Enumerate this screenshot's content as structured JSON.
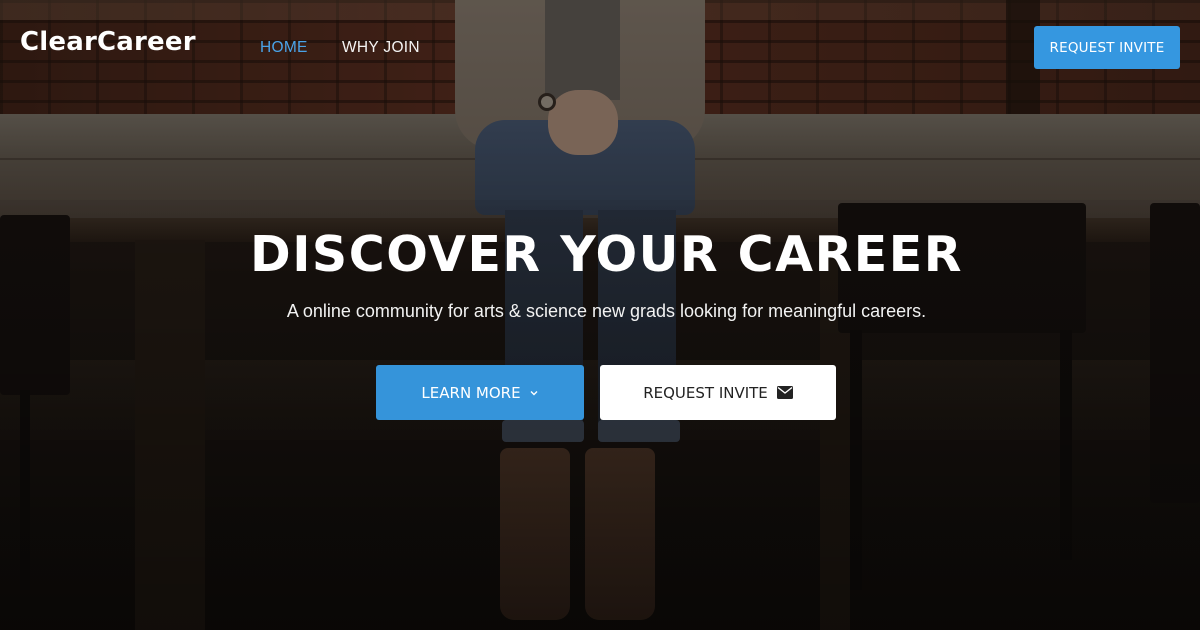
{
  "brand": {
    "name": "ClearCareer"
  },
  "nav": {
    "links": [
      {
        "label": "HOME",
        "active": true
      },
      {
        "label": "WHY JOIN",
        "active": false
      }
    ],
    "cta_label": "REQUEST INVITE"
  },
  "hero": {
    "headline": "DISCOVER YOUR CAREER",
    "subheadline": "A online community for arts & science new grads looking for meaningful careers.",
    "primary_button": {
      "label": "LEARN MORE",
      "icon": "chevron-down-icon"
    },
    "secondary_button": {
      "label": "REQUEST INVITE",
      "icon": "envelope-icon"
    }
  },
  "colors": {
    "accent": "#3597e0",
    "active_link": "#4aa3e8",
    "text_light": "#ffffff"
  }
}
